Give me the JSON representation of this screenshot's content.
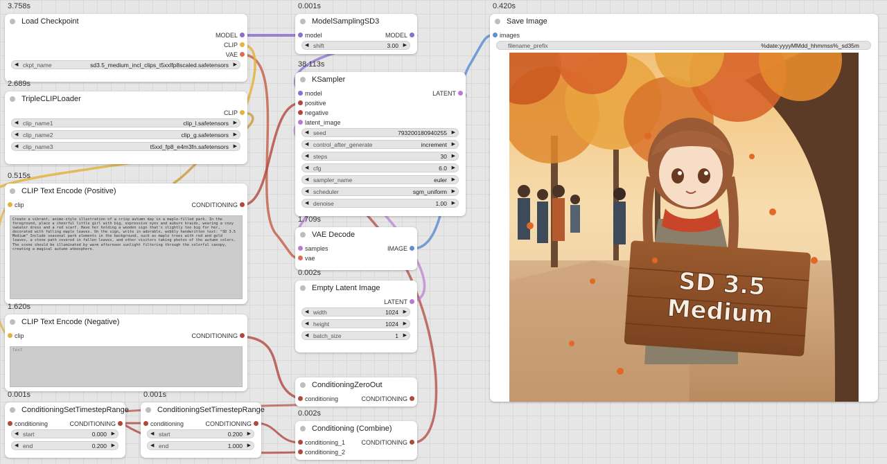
{
  "colors": {
    "model": "#8a6fd0",
    "clip": "#e2b33e",
    "vae": "#e06a57",
    "conditioning": "#b0483e",
    "latent": "#b77ad2",
    "image": "#5f8fcf",
    "canvas": "#e6e6e6",
    "node": "#ffffff"
  },
  "nodes": {
    "load_checkpoint": {
      "timing": "3.758s",
      "title": "Load Checkpoint",
      "outputs": {
        "model": "MODEL",
        "clip": "CLIP",
        "vae": "VAE"
      },
      "ckpt_name": {
        "label": "ckpt_name",
        "value": "sd3.5_medium_incl_clips_t5xxlfp8scaled.safetensors"
      }
    },
    "triple_clip": {
      "timing": "2.689s",
      "title": "TripleCLIPLoader",
      "outputs": {
        "clip": "CLIP"
      },
      "widgets": [
        {
          "label": "clip_name1",
          "value": "clip_l.safetensors"
        },
        {
          "label": "clip_name2",
          "value": "clip_g.safetensors"
        },
        {
          "label": "clip_name3",
          "value": "t5xxl_fp8_e4m3fn.safetensors"
        }
      ]
    },
    "clip_pos": {
      "timing": "0.515s",
      "title": "CLIP Text Encode (Positive)",
      "inputs": {
        "clip": "clip"
      },
      "outputs": {
        "conditioning": "CONDITIONING"
      },
      "text": "Create a vibrant, anime-style illustration of a crisp autumn day in a maple-filled park. In the foreground, place a cheerful little girl with big, expressive eyes and auburn braids, wearing a cozy sweater dress and a red scarf. Have her holding a wooden sign that's slightly too big for her, decorated with falling maple leaves. On the sign, write in adorable, wobbly handwritten text: \"SD 3.5 Medium\" Include seasonal park elements in the background, such as maple trees with red and gold leaves, a stone path covered in fallen leaves, and other visitors taking photos of the autumn colors. The scene should be illuminated by warm afternoon sunlight filtering through the colorful canopy, creating a magical autumn atmosphere."
    },
    "clip_neg": {
      "timing": "1.620s",
      "title": "CLIP Text Encode (Negative)",
      "inputs": {
        "clip": "clip"
      },
      "outputs": {
        "conditioning": "CONDITIONING"
      },
      "placeholder": "text"
    },
    "cond_range1": {
      "timing": "0.001s",
      "title": "ConditioningSetTimestepRange",
      "inputs": {
        "conditioning": "conditioning"
      },
      "outputs": {
        "conditioning": "CONDITIONING"
      },
      "widgets": [
        {
          "label": "start",
          "value": "0.000"
        },
        {
          "label": "end",
          "value": "0.200"
        }
      ]
    },
    "cond_range2": {
      "timing": "0.001s",
      "title": "ConditioningSetTimestepRange",
      "inputs": {
        "conditioning": "conditioning"
      },
      "outputs": {
        "conditioning": "CONDITIONING"
      },
      "widgets": [
        {
          "label": "start",
          "value": "0.200"
        },
        {
          "label": "end",
          "value": "1.000"
        }
      ]
    },
    "model_sampling": {
      "timing": "0.001s",
      "title": "ModelSamplingSD3",
      "inputs": {
        "model": "model"
      },
      "outputs": {
        "model": "MODEL"
      },
      "widgets": [
        {
          "label": "shift",
          "value": "3.00"
        }
      ]
    },
    "ksampler": {
      "timing": "38.113s",
      "title": "KSampler",
      "inputs": {
        "model": "model",
        "positive": "positive",
        "negative": "negative",
        "latent_image": "latent_image"
      },
      "outputs": {
        "latent": "LATENT"
      },
      "widgets": [
        {
          "label": "seed",
          "value": "793200180940255"
        },
        {
          "label": "control_after_generate",
          "value": "increment"
        },
        {
          "label": "steps",
          "value": "30"
        },
        {
          "label": "cfg",
          "value": "6.0"
        },
        {
          "label": "sampler_name",
          "value": "euler"
        },
        {
          "label": "scheduler",
          "value": "sgm_uniform"
        },
        {
          "label": "denoise",
          "value": "1.00"
        }
      ]
    },
    "vae_decode": {
      "timing": "1.709s",
      "title": "VAE Decode",
      "inputs": {
        "samples": "samples",
        "vae": "vae"
      },
      "outputs": {
        "image": "IMAGE"
      }
    },
    "empty_latent": {
      "timing": "0.002s",
      "title": "Empty Latent Image",
      "outputs": {
        "latent": "LATENT"
      },
      "widgets": [
        {
          "label": "width",
          "value": "1024"
        },
        {
          "label": "height",
          "value": "1024"
        },
        {
          "label": "batch_size",
          "value": "1"
        }
      ]
    },
    "cond_zero": {
      "title": "ConditioningZeroOut",
      "inputs": {
        "conditioning": "conditioning"
      },
      "outputs": {
        "conditioning": "CONDITIONING"
      }
    },
    "cond_combine": {
      "timing": "0.002s",
      "title": "Conditioning (Combine)",
      "inputs": {
        "conditioning_1": "conditioning_1",
        "conditioning_2": "conditioning_2"
      },
      "outputs": {
        "conditioning": "CONDITIONING"
      }
    },
    "save_image": {
      "timing": "0.420s",
      "title": "Save Image",
      "inputs": {
        "images": "images"
      },
      "filename_prefix": {
        "label": "filename_prefix",
        "value": "%date:yyyyMMdd_hhmmss%_sd35m"
      },
      "preview": {
        "sign_line1": "SD 3.5",
        "sign_line2": "Medium"
      }
    }
  }
}
